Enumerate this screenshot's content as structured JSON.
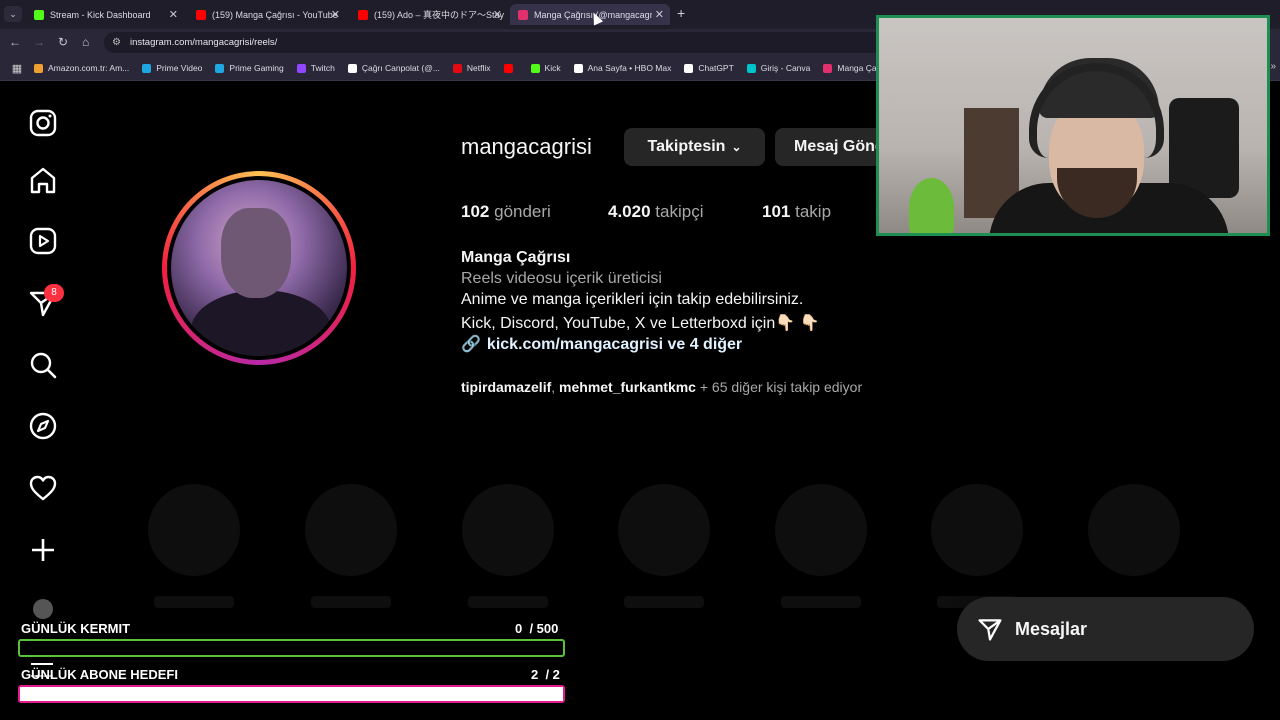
{
  "browser": {
    "tabs": [
      {
        "label": "Stream - Kick Dashboard",
        "color": "#53fc18",
        "active": false
      },
      {
        "label": "(159) Manga Çağrısı - YouTube",
        "color": "#ff0000",
        "active": false
      },
      {
        "label": "(159) Ado – 真夜中のドア～Stay",
        "color": "#ff0000",
        "active": false
      },
      {
        "label": "Manga Çağrısı (@mangacagrisi",
        "color": "#e1306c",
        "active": true
      }
    ],
    "new_tab": "+",
    "url": "instagram.com/mangacagrisi/reels/",
    "bookmarks": [
      {
        "label": "Amazon.com.tr: Am...",
        "color": "#f0a030"
      },
      {
        "label": "Prime Video",
        "color": "#1ea7e1"
      },
      {
        "label": "Prime Gaming",
        "color": "#1ea7e1"
      },
      {
        "label": "Twitch",
        "color": "#9146ff"
      },
      {
        "label": "Çağrı Canpolat (@...",
        "color": "#ffffff"
      },
      {
        "label": "Netflix",
        "color": "#e50914"
      },
      {
        "label": "",
        "color": "#ff0000"
      },
      {
        "label": "Kick",
        "color": "#53fc18"
      },
      {
        "label": "Ana Sayfa • HBO Max",
        "color": "#ffffff"
      },
      {
        "label": "ChatGPT",
        "color": "#ffffff"
      },
      {
        "label": "Giriş - Canva",
        "color": "#00c4cc"
      },
      {
        "label": "Manga Çağrısı (@M...",
        "color": "#e1306c"
      }
    ]
  },
  "profile": {
    "username": "mangacagrisi",
    "follow_button": "Takiptesin",
    "message_button": "Mesaj Gönder",
    "stats": [
      {
        "count": "102",
        "label": "gönderi"
      },
      {
        "count": "4.020",
        "label": "takipçi"
      },
      {
        "count": "101",
        "label": "takip"
      }
    ],
    "display_name": "Manga Çağrısı",
    "category": "Reels videosu içerik üreticisi",
    "bio_line1": "Anime ve manga içerikleri için takip edebilirsiniz.",
    "bio_line2": "Kick, Discord, YouTube, X ve Letterboxd için👇🏻 👇🏻",
    "link": "kick.com/mangacagrisi ve 4 diğer",
    "followed_by_user1": "tipirdamazelif",
    "followed_by_user2": "mehmet_furkantkmc",
    "followed_by_rest": " + 65 diğer kişi takip ediyor"
  },
  "sidebar": {
    "notification_count": "8"
  },
  "messages_button": "Mesajlar",
  "overlay": {
    "goal1_label": "GÜNLÜK KERMIT",
    "goal1_value": "0  / 500",
    "goal1_progress": 0,
    "goal2_label": "GÜNLÜK ABONE HEDEFI",
    "goal2_value": "2  / 2",
    "goal2_progress": 1.0,
    "goal1_color": "#58c23a",
    "goal2_color": "#e21a8e"
  }
}
